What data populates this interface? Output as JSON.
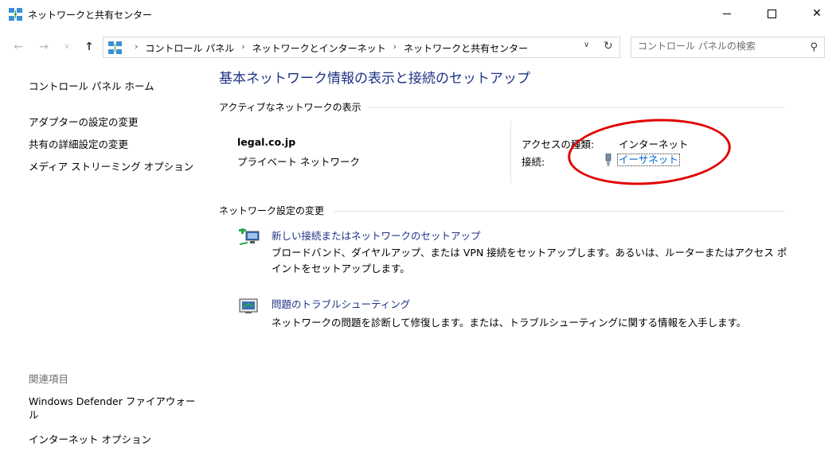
{
  "window": {
    "title": "ネットワークと共有センター",
    "minimize_icon": "minimize-icon",
    "maximize_icon": "maximize-icon",
    "close_glyph": "✕"
  },
  "nav": {
    "back_glyph": "←",
    "forward_glyph": "→",
    "recent_glyph": "∨",
    "up_glyph": "↑",
    "breadcrumbs": [
      "コントロール パネル",
      "ネットワークとインターネット",
      "ネットワークと共有センター"
    ],
    "separator": "›",
    "dropdown_glyph": "∨",
    "refresh_glyph": "↻",
    "search_placeholder": "コントロール パネルの検索",
    "search_glyph": "⚲"
  },
  "sidebar": {
    "home": "コントロール パネル ホーム",
    "links": [
      "アダプターの設定の変更",
      "共有の詳細設定の変更",
      "メディア ストリーミング オプション"
    ],
    "related_heading": "関連項目",
    "related_links": [
      "Windows Defender ファイアウォール",
      "インターネット オプション"
    ]
  },
  "main": {
    "title": "基本ネットワーク情報の表示と接続のセットアップ",
    "active_networks_heading": "アクティブなネットワークの表示",
    "network": {
      "name": "legal.co.jp",
      "type": "プライベート ネットワーク",
      "access_type_label": "アクセスの種類:",
      "access_type_value": "インターネット",
      "connection_label": "接続:",
      "connection_value": "イーサネット"
    },
    "change_settings_heading": "ネットワーク設定の変更",
    "tasks": [
      {
        "title": "新しい接続またはネットワークのセットアップ",
        "description": "ブロードバンド、ダイヤルアップ、または VPN 接続をセットアップします。あるいは、ルーターまたはアクセス ポイントをセットアップします。"
      },
      {
        "title": "問題のトラブルシューティング",
        "description": "ネットワークの問題を診断して修復します。または、トラブルシューティングに関する情報を入手します。"
      }
    ]
  },
  "colors": {
    "link_blue": "#1e3287",
    "hyperlink": "#0066cc",
    "annotation": "#e00000"
  }
}
